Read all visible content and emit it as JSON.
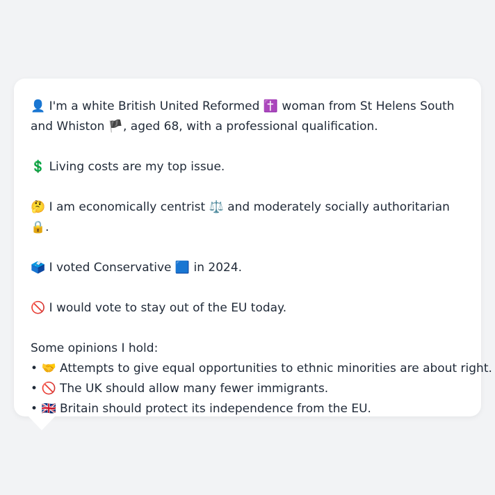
{
  "message": {
    "intro_icon": "👤",
    "intro_text_1": "I'm a white British United Reformed",
    "religion_icon": "✝️",
    "intro_text_2": "woman from St Helens South and Whiston",
    "flag_icon": "🏴",
    "intro_text_3": ", aged 68, with a professional qualification.",
    "issue_icon": "💲",
    "issue_text": "Living costs are my top issue.",
    "stance_icon": "🤔",
    "stance_text_1": "I am economically centrist",
    "scales_icon": "⚖️",
    "stance_text_2": "and moderately socially authoritarian",
    "lock_icon": "🔒",
    "stance_text_3": ".",
    "vote_icon": "🗳️",
    "vote_text_1": "I voted Conservative",
    "party_icon": "🟦",
    "vote_text_2": "in 2024.",
    "eu_icon": "🚫",
    "eu_text": "I would vote to stay out of the EU today.",
    "opinions_heading": "Some opinions I hold:",
    "opinions": [
      {
        "bullet": "•",
        "icon": "🤝",
        "text": "Attempts to give equal opportunities to ethnic minorities are about right."
      },
      {
        "bullet": "•",
        "icon": "🚫",
        "text": "The UK should allow many fewer immigrants."
      },
      {
        "bullet": "•",
        "icon": "🇬🇧",
        "text": "Britain should protect its independence from the EU."
      }
    ]
  }
}
